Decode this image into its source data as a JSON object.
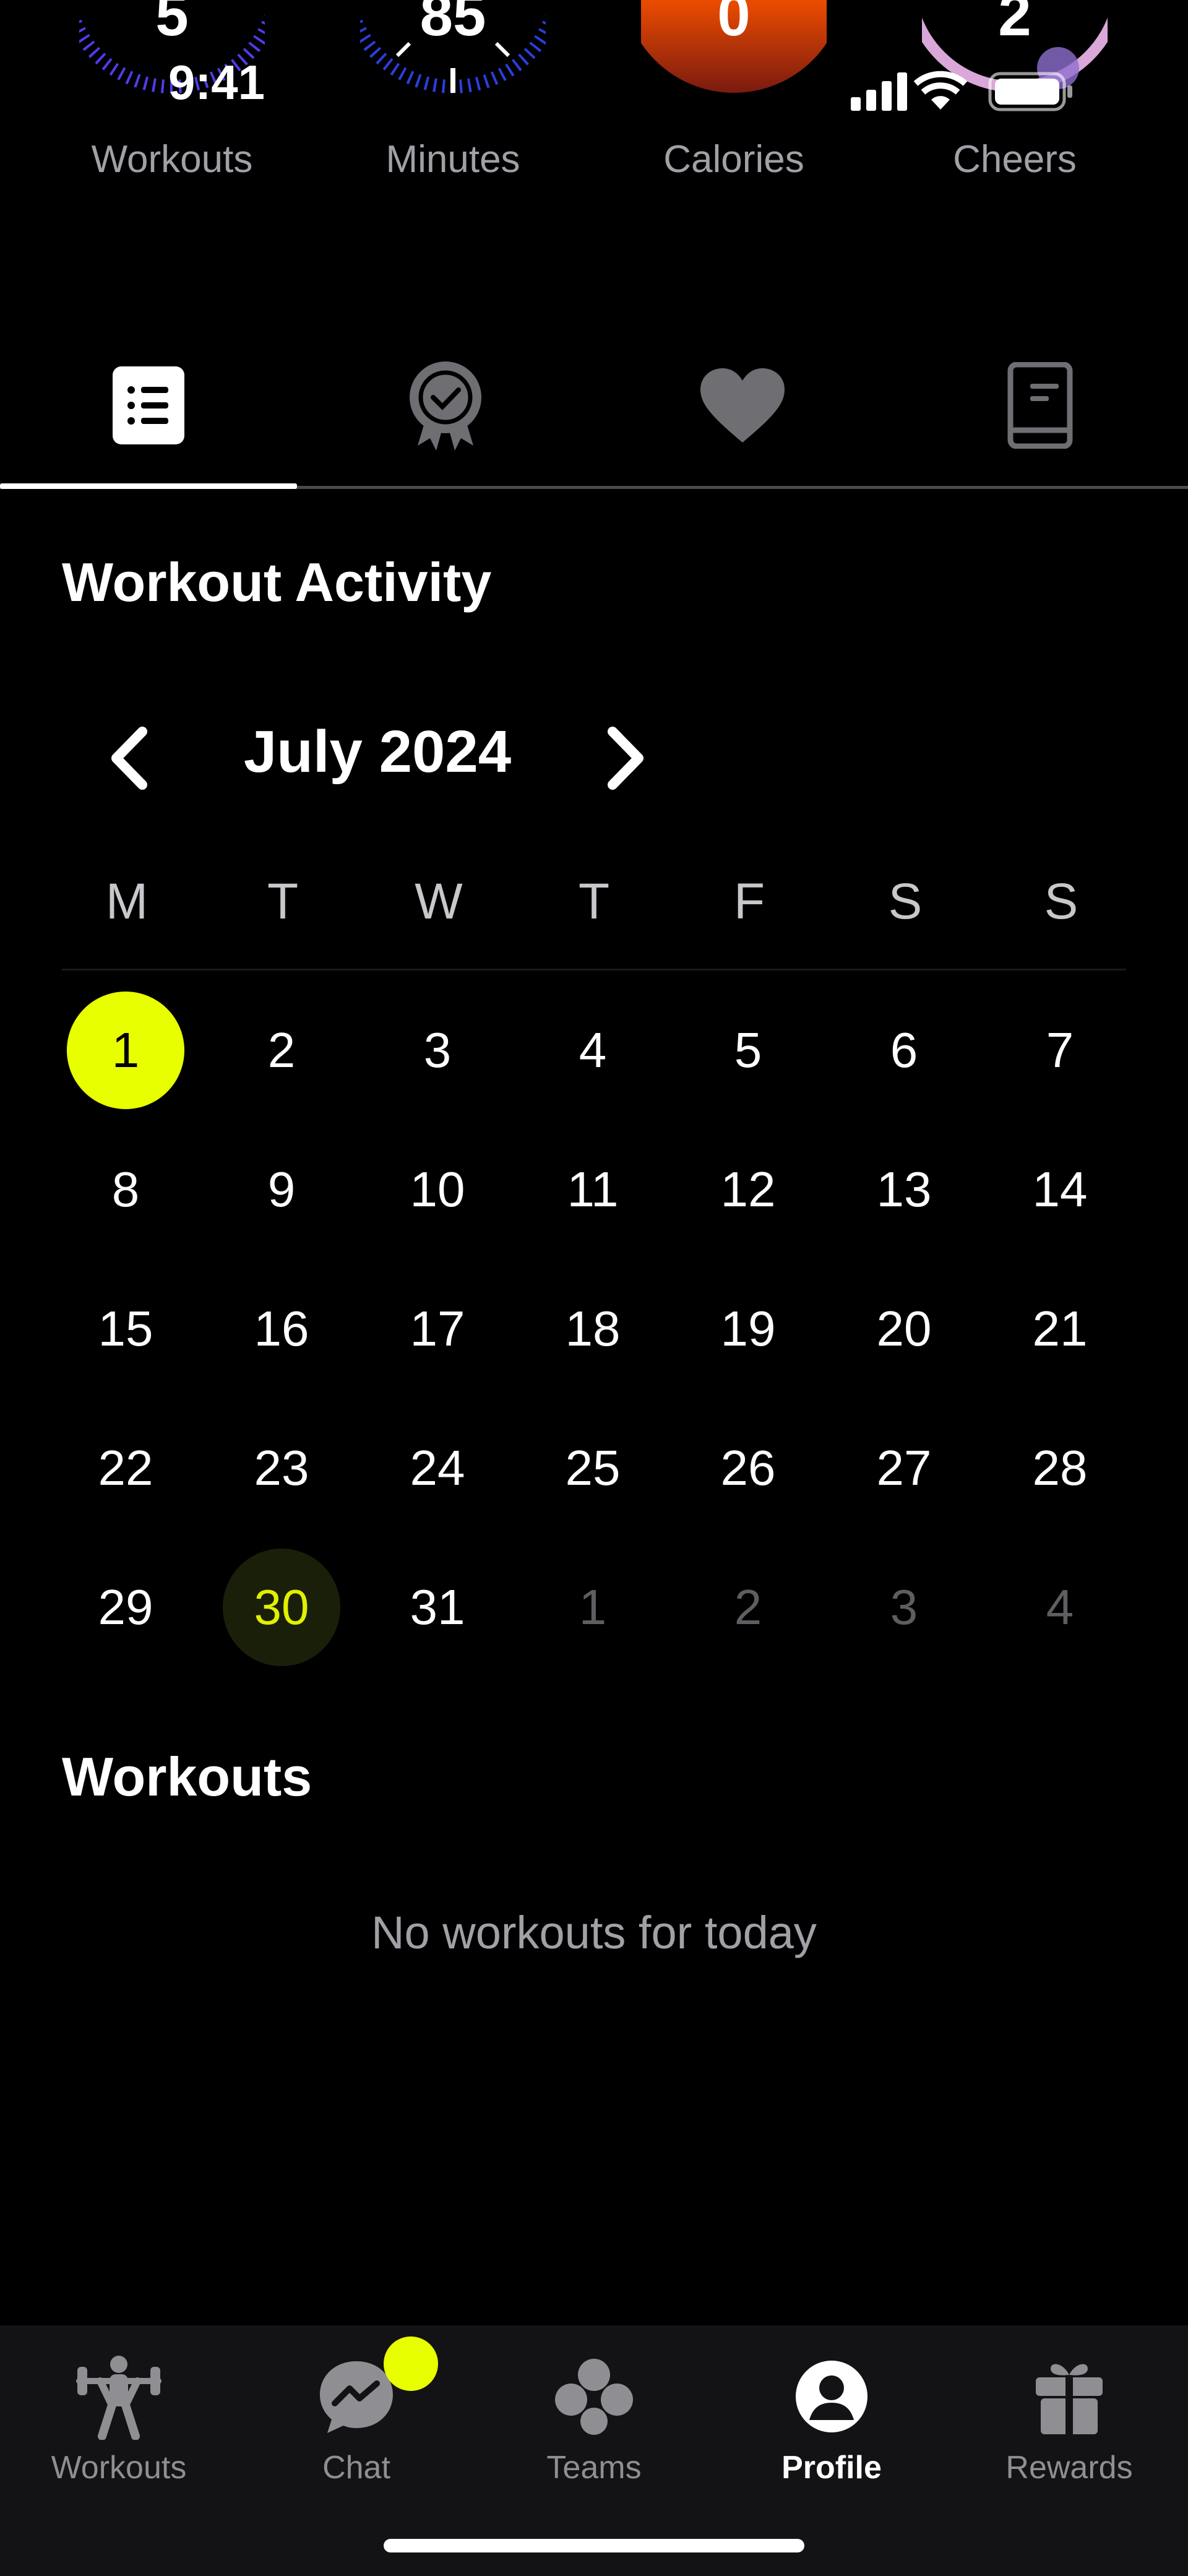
{
  "status_bar": {
    "time": "9:41"
  },
  "stats": [
    {
      "value": "5",
      "label": "Workouts"
    },
    {
      "value": "85",
      "label": "Minutes"
    },
    {
      "value": "0",
      "label": "Calories"
    },
    {
      "value": "2",
      "label": "Cheers"
    }
  ],
  "tabs": [
    {
      "icon": "list-icon",
      "active": true
    },
    {
      "icon": "badge-check-icon",
      "active": false
    },
    {
      "icon": "heart-icon",
      "active": false
    },
    {
      "icon": "book-icon",
      "active": false
    }
  ],
  "activity": {
    "title": "Workout Activity",
    "month": "July 2024",
    "weekdays": [
      "M",
      "T",
      "W",
      "T",
      "F",
      "S",
      "S"
    ],
    "weeks": [
      [
        "1",
        "2",
        "3",
        "4",
        "5",
        "6",
        "7"
      ],
      [
        "8",
        "9",
        "10",
        "11",
        "12",
        "13",
        "14"
      ],
      [
        "15",
        "16",
        "17",
        "18",
        "19",
        "20",
        "21"
      ],
      [
        "22",
        "23",
        "24",
        "25",
        "26",
        "27",
        "28"
      ],
      [
        "29",
        "30",
        "31",
        "1",
        "2",
        "3",
        "4"
      ]
    ],
    "selected_day": "1",
    "today": "30"
  },
  "workouts": {
    "title": "Workouts",
    "empty_text": "No workouts for today"
  },
  "bottom_nav": [
    {
      "label": "Workouts",
      "icon": "weightlifter-icon",
      "active": false
    },
    {
      "label": "Chat",
      "icon": "chat-bubble-icon",
      "active": false,
      "badge": true
    },
    {
      "label": "Teams",
      "icon": "teams-icon",
      "active": false
    },
    {
      "label": "Profile",
      "icon": "profile-icon",
      "active": true
    },
    {
      "label": "Rewards",
      "icon": "gift-icon",
      "active": false
    }
  ],
  "colors": {
    "accent": "#E8FF00",
    "background": "#000000",
    "nav_background": "#131315",
    "muted_text": "#8E8E93",
    "workouts_ring": "#4F3CF0",
    "minutes_ring": "#2A3FE0",
    "calories_ring": "#FF6A00",
    "cheers_ring": "#D9A8D8"
  }
}
